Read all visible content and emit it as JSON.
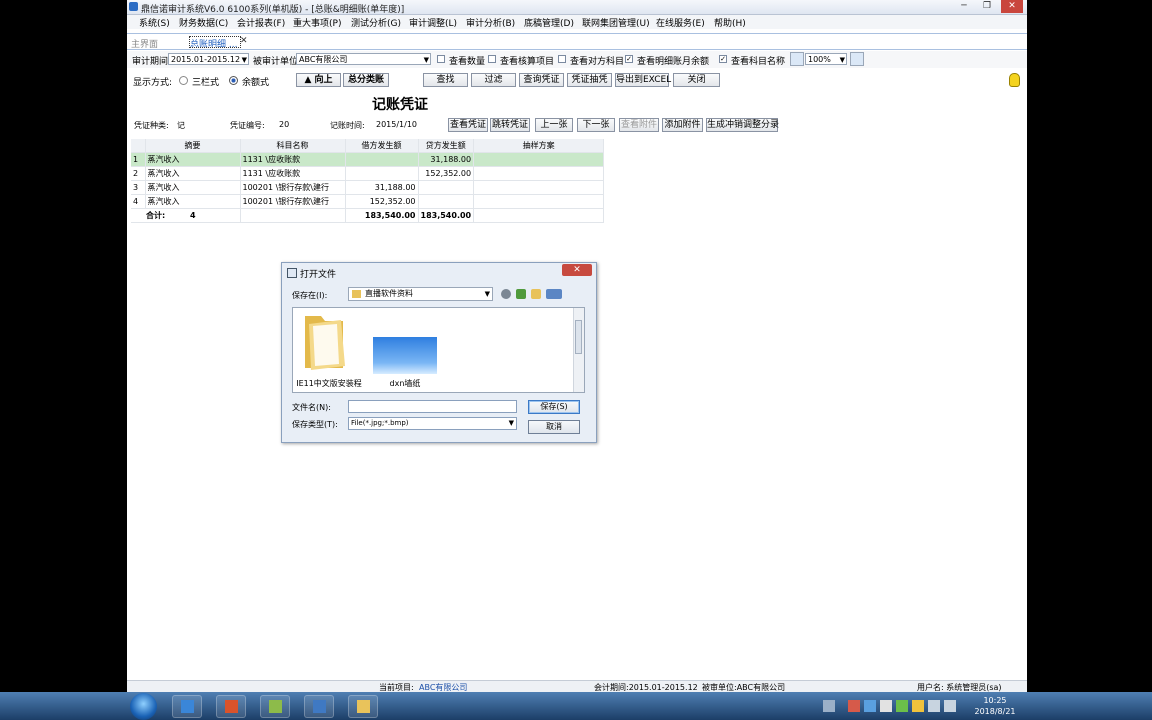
{
  "window": {
    "title": "鼎信诺审计系统V6.0 6100系列(单机版) - [总账&明细账(单年度)]",
    "minimize": "─",
    "restore": "❐",
    "close": "✕"
  },
  "menu": [
    "系统(S)",
    "财务数据(C)",
    "会计报表(F)",
    "重大事项(P)",
    "测试分析(G)",
    "审计调整(L)",
    "审计分析(B)",
    "底稿管理(D)",
    "联网集团管理(U)",
    "在线服务(E)",
    "帮助(H)"
  ],
  "tabs": {
    "main": "主界面",
    "active": "总账明细 ...",
    "close": "✕"
  },
  "toolbar": {
    "period_label": "审计期间",
    "period_value": "2015.01-2015.12",
    "unit_label": "被审计单位",
    "unit_value": "ABC有限公司",
    "checks": [
      {
        "label": "查看数量",
        "checked": false
      },
      {
        "label": "查看核算项目",
        "checked": false
      },
      {
        "label": "查看对方科目",
        "checked": false
      },
      {
        "label": "查看明细账月余额",
        "checked": true
      },
      {
        "label": "查看科目名称",
        "checked": true
      }
    ],
    "zoom": "100%"
  },
  "display": {
    "label": "显示方式:",
    "option1": "三栏式",
    "option2": "余额式",
    "selected": "余额式"
  },
  "buttons_row1": {
    "up": "▲ 向上",
    "summary": "总分类账",
    "find": "查找",
    "filter": "过滤",
    "query_voucher": "查询凭证",
    "voucher_sample": "凭证抽凭",
    "export_excel": "导出到EXCEL",
    "close": "关闭"
  },
  "voucher": {
    "title": "记账凭证",
    "type_label": "凭证种类:",
    "type_value": "记",
    "no_label": "凭证编号:",
    "no_value": "20",
    "date_label": "记账时间:",
    "date_value": "2015/1/10",
    "buttons": {
      "view": "查看凭证",
      "jump": "跳转凭证",
      "prev": "上一张",
      "next": "下一张",
      "attach_view": "查看附件",
      "attach_add": "添加附件",
      "gen_adjust": "生成冲销调整分录"
    }
  },
  "grid": {
    "columns": [
      "",
      "摘要",
      "科目名称",
      "借方发生额",
      "贷方发生额",
      "抽样方案"
    ],
    "rows": [
      {
        "no": "1",
        "summary": "蒸汽收入",
        "account": "1131 \\应收账款",
        "debit": "",
        "credit": "31,188.00",
        "plan": ""
      },
      {
        "no": "2",
        "summary": "蒸汽收入",
        "account": "1131 \\应收账款",
        "debit": "",
        "credit": "152,352.00",
        "plan": ""
      },
      {
        "no": "3",
        "summary": "蒸汽收入",
        "account": "100201 \\银行存款\\建行",
        "debit": "31,188.00",
        "credit": "",
        "plan": ""
      },
      {
        "no": "4",
        "summary": "蒸汽收入",
        "account": "100201 \\银行存款\\建行",
        "debit": "152,352.00",
        "credit": "",
        "plan": ""
      }
    ],
    "total": {
      "label": "合计:",
      "count": "4",
      "debit": "183,540.00",
      "credit": "183,540.00"
    }
  },
  "dialog": {
    "title": "打开文件",
    "save_in_label": "保存在(I):",
    "folder": "直播软件资料",
    "files": [
      {
        "name": "IE11中文版安装程",
        "icon": "folder-icon"
      },
      {
        "name": "dxn墙纸",
        "icon": "image-thumbnail"
      }
    ],
    "filename_label": "文件名(N):",
    "filename_value": "",
    "filetype_label": "保存类型(T):",
    "filetype_value": "File(*.jpg;*.bmp)",
    "save_button": "保存(S)",
    "cancel_button": "取消"
  },
  "status": {
    "project_label": "当前项目:",
    "project_value": "ABC有限公司",
    "period": "会计期间:2015.01-2015.12",
    "unit": "被审单位:ABC有限公司",
    "user": "用户名: 系统管理员(sa)"
  },
  "taskbar": {
    "time": "10:25",
    "date": "2018/8/21"
  }
}
